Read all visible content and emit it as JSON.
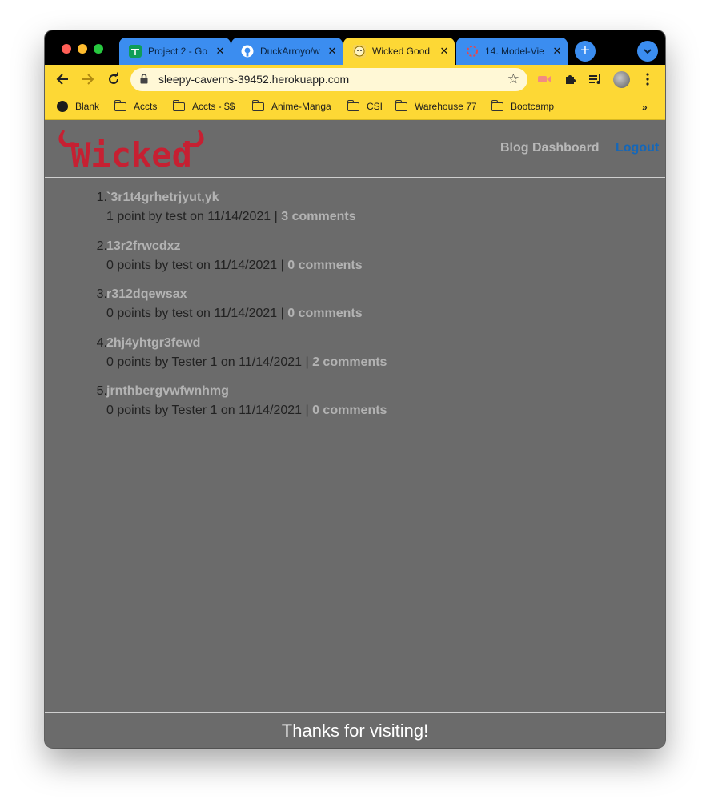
{
  "browser": {
    "tabs": [
      {
        "title": "Project 2 - Go",
        "icon": "google-sheets-icon",
        "active": false
      },
      {
        "title": "DuckArroyo/w",
        "icon": "github-icon",
        "active": false
      },
      {
        "title": "Wicked Good",
        "icon": "wicked-favicon",
        "active": true
      },
      {
        "title": "14. Model-Vie",
        "icon": "loading-spinner-icon",
        "active": false
      }
    ],
    "new_tab_label": "+",
    "url": "sleepy-caverns-39452.herokuapp.com",
    "bookmarks": [
      {
        "label": "Blank",
        "icon": "globe-icon"
      },
      {
        "label": "Accts",
        "icon": "folder-icon"
      },
      {
        "label": "Accts - $$",
        "icon": "folder-icon"
      },
      {
        "label": "Anime-Manga",
        "icon": "folder-icon"
      },
      {
        "label": "CSI",
        "icon": "folder-icon"
      },
      {
        "label": "Warehouse 77",
        "icon": "folder-icon"
      },
      {
        "label": "Bootcamp",
        "icon": "folder-icon"
      }
    ],
    "bookmarks_more": "»",
    "colors": {
      "tab_blue": "#3b8df0",
      "theme_yellow": "#fdd835"
    }
  },
  "site": {
    "logo_text": "Wicked",
    "nav": {
      "dashboard": "Blog Dashboard",
      "logout": "Logout"
    },
    "posts": [
      {
        "num": "1.",
        "title": "`3r1t4grhetrjyut,yk",
        "meta": "1 point by test on 11/14/2021 | ",
        "comments": "3 comments"
      },
      {
        "num": "2.",
        "title": "13r2frwcdxz",
        "meta": "0 points by test on 11/14/2021 | ",
        "comments": "0 comments"
      },
      {
        "num": "3.",
        "title": "r312dqewsax",
        "meta": "0 points by test on 11/14/2021 | ",
        "comments": "0 comments"
      },
      {
        "num": "4.",
        "title": "2hj4yhtgr3fewd",
        "meta": "0 points by Tester 1 on 11/14/2021 | ",
        "comments": "2 comments"
      },
      {
        "num": "5.",
        "title": "jrnthbergvwfwnhmg",
        "meta": "0 points by Tester 1 on 11/14/2021 | ",
        "comments": "0 comments"
      }
    ],
    "footer": "Thanks for visiting!",
    "colors": {
      "page_bg": "#6b6b6b",
      "logo_red": "#c62032",
      "logout_blue": "#1567b8",
      "muted_link": "#b3b3b3"
    }
  }
}
